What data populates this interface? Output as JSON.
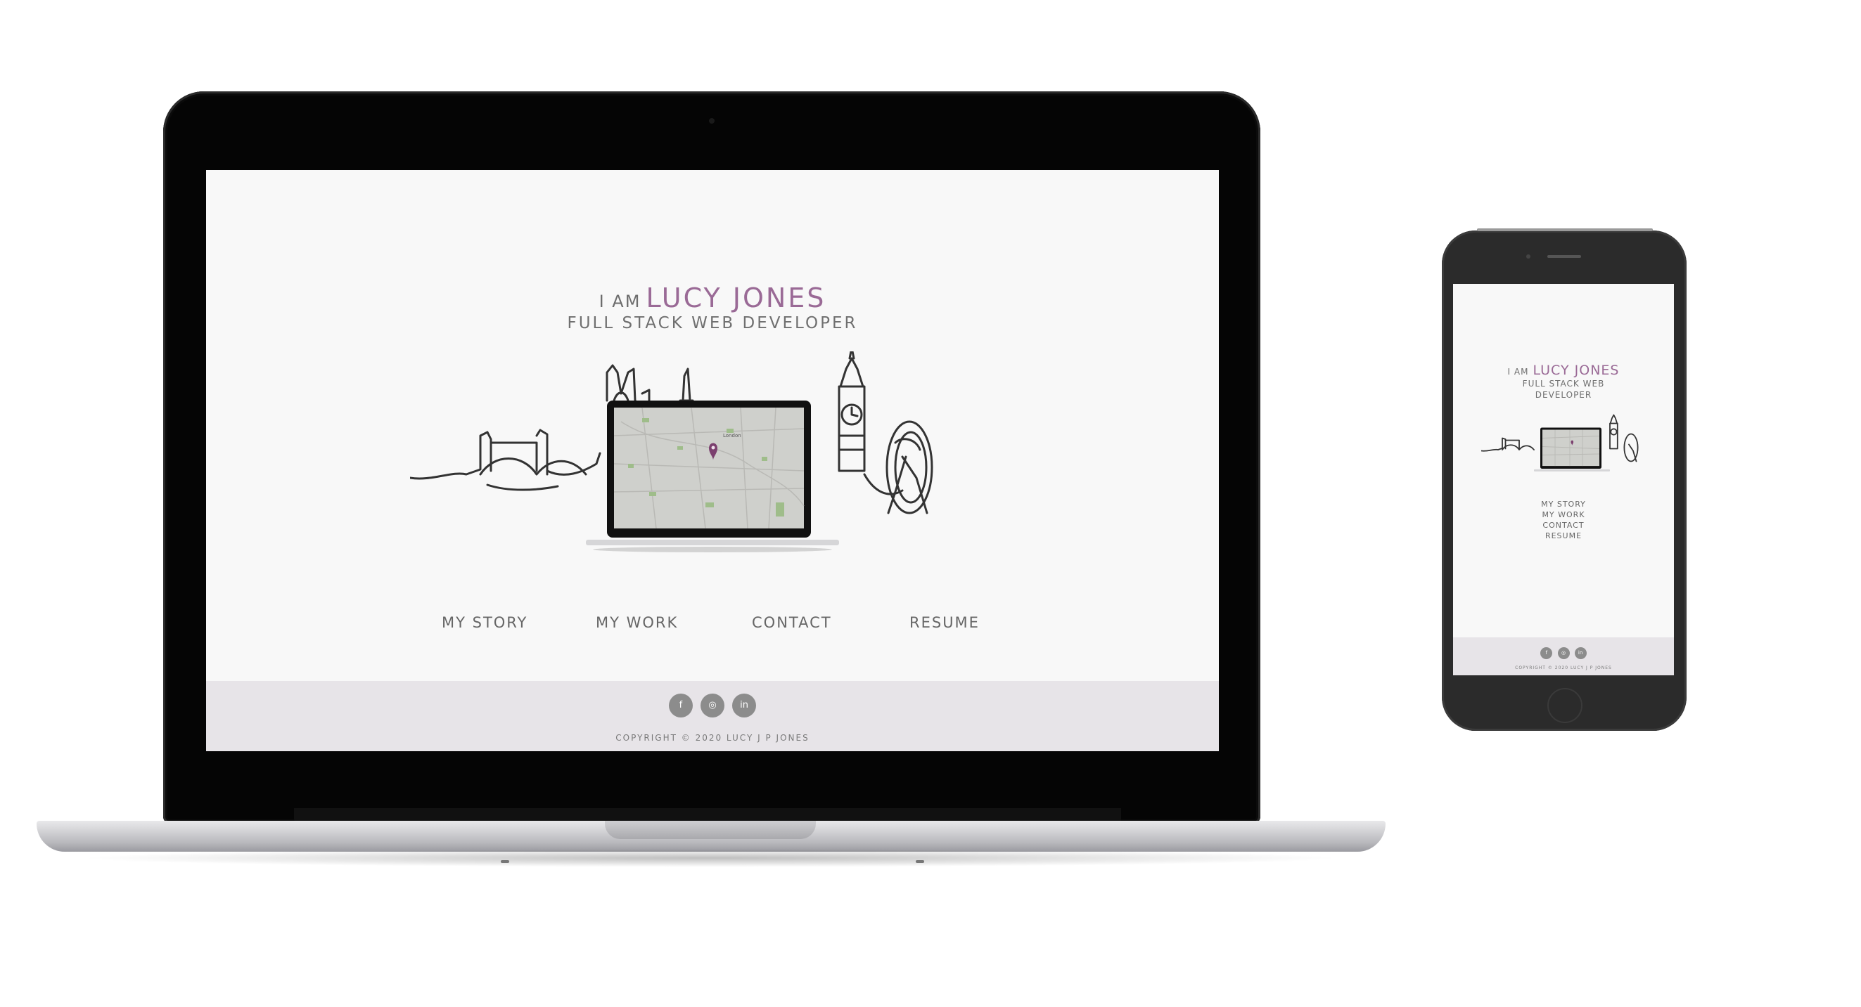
{
  "hero": {
    "iam": "I AM",
    "name": "LUCY JONES",
    "role": "FULL STACK WEB DEVELOPER"
  },
  "nav": {
    "items": [
      "MY STORY",
      "MY WORK",
      "CONTACT",
      "RESUME"
    ]
  },
  "social": [
    {
      "icon": "facebook-icon",
      "glyph": "f"
    },
    {
      "icon": "instagram-icon",
      "glyph": "◎"
    },
    {
      "icon": "linkedin-icon",
      "glyph": "in"
    }
  ],
  "footer": {
    "copyright": "COPYRIGHT © 2020 LUCY J P JONES"
  },
  "phone": {
    "role_line1": "FULL STACK WEB",
    "role_line2": "DEVELOPER"
  },
  "map": {
    "label": "London"
  },
  "colors": {
    "accent": "#9a6a96",
    "footer_bg": "#e7e4e8",
    "page_bg": "#f8f8f8",
    "social_bg": "#8c8c8c"
  }
}
